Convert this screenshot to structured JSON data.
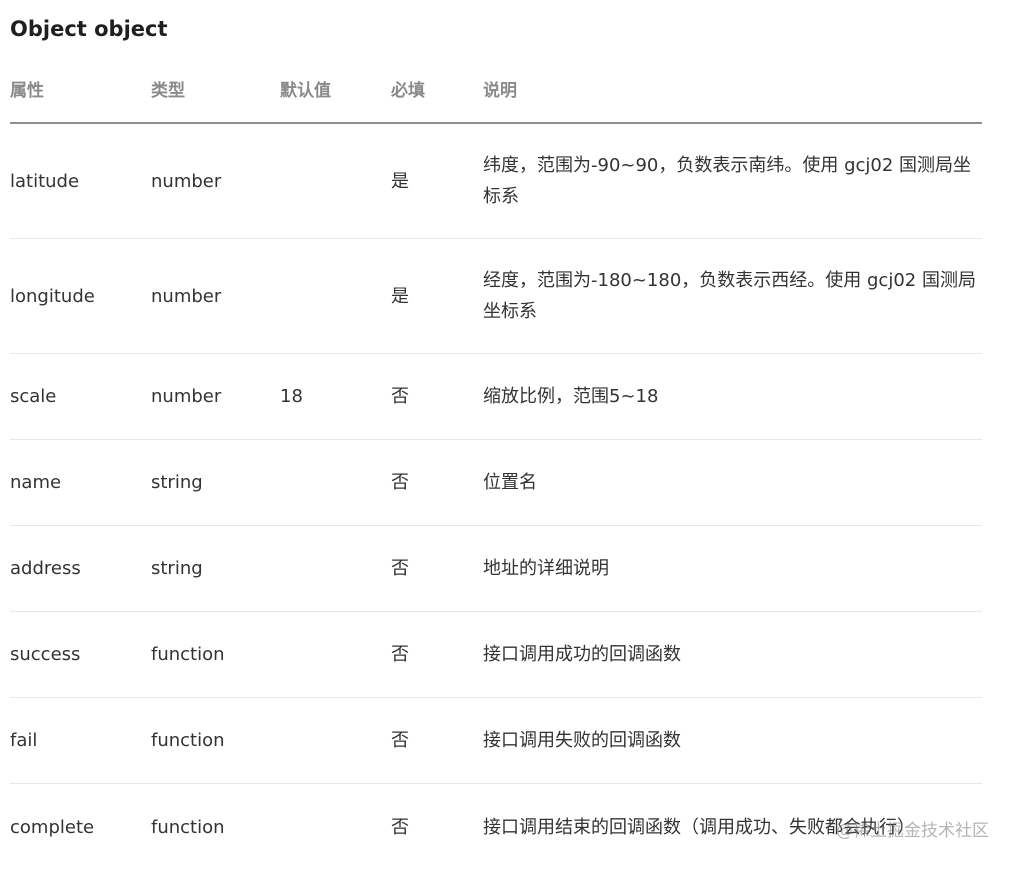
{
  "title": "Object object",
  "table": {
    "headers": [
      "属性",
      "类型",
      "默认值",
      "必填",
      "说明"
    ],
    "rows": [
      {
        "name": "latitude",
        "type": "number",
        "default": "",
        "required": "是",
        "desc": "纬度，范围为-90~90，负数表示南纬。使用 gcj02 国测局坐标系"
      },
      {
        "name": "longitude",
        "type": "number",
        "default": "",
        "required": "是",
        "desc": "经度，范围为-180~180，负数表示西经。使用 gcj02 国测局坐标系"
      },
      {
        "name": "scale",
        "type": "number",
        "default": "18",
        "required": "否",
        "desc": "缩放比例，范围5~18"
      },
      {
        "name": "name",
        "type": "string",
        "default": "",
        "required": "否",
        "desc": "位置名"
      },
      {
        "name": "address",
        "type": "string",
        "default": "",
        "required": "否",
        "desc": "地址的详细说明"
      },
      {
        "name": "success",
        "type": "function",
        "default": "",
        "required": "否",
        "desc": "接口调用成功的回调函数"
      },
      {
        "name": "fail",
        "type": "function",
        "default": "",
        "required": "否",
        "desc": "接口调用失败的回调函数"
      },
      {
        "name": "complete",
        "type": "function",
        "default": "",
        "required": "否",
        "desc": "接口调用结束的回调函数（调用成功、失败都会执行）"
      }
    ]
  },
  "watermark": "@稀土掘金技术社区"
}
